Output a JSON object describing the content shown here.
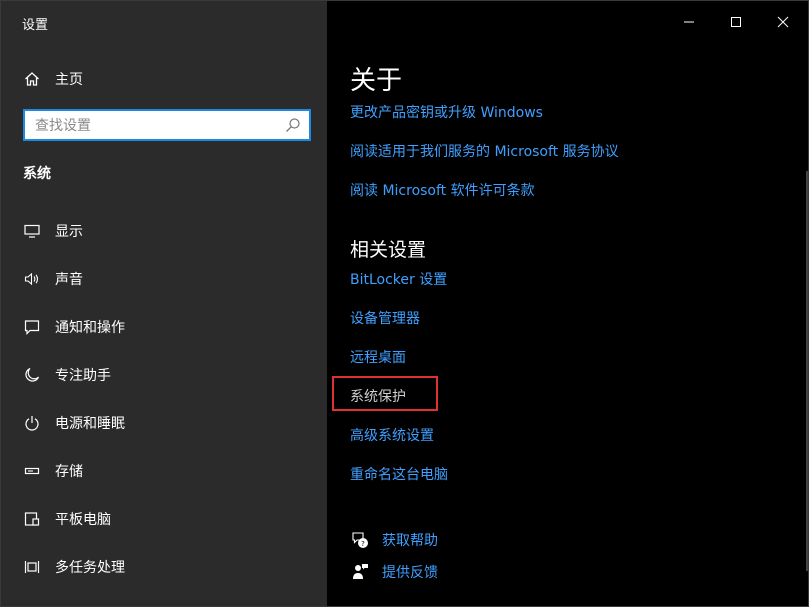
{
  "app": {
    "title": "设置"
  },
  "colors": {
    "link": "#3fa0ff",
    "sidebar_bg": "#2b2b2b",
    "main_bg": "#000000",
    "search_border": "#1e88e5",
    "highlight": "#e03131"
  },
  "sidebar": {
    "home": {
      "label": "主页",
      "icon": "home-icon"
    },
    "search": {
      "placeholder": "查找设置",
      "icon": "search-icon"
    },
    "section_title": "系统",
    "items": [
      {
        "label": "显示",
        "icon": "monitor-icon"
      },
      {
        "label": "声音",
        "icon": "speaker-icon"
      },
      {
        "label": "通知和操作",
        "icon": "notification-icon"
      },
      {
        "label": "专注助手",
        "icon": "moon-icon"
      },
      {
        "label": "电源和睡眠",
        "icon": "power-icon"
      },
      {
        "label": "存储",
        "icon": "storage-icon"
      },
      {
        "label": "平板电脑",
        "icon": "tablet-icon"
      },
      {
        "label": "多任务处理",
        "icon": "multitasking-icon"
      }
    ]
  },
  "titlebar": {
    "minimize": "minimize-icon",
    "maximize": "maximize-icon",
    "close": "close-icon"
  },
  "main": {
    "heading": "关于",
    "about_links": [
      "更改产品密钥或升级 Windows",
      "阅读适用于我们服务的 Microsoft 服务协议",
      "阅读 Microsoft 软件许可条款"
    ],
    "related_heading": "相关设置",
    "related_links": [
      "BitLocker 设置",
      "设备管理器",
      "远程桌面",
      "系统保护",
      "高级系统设置",
      "重命名这台电脑"
    ],
    "help": [
      {
        "label": "获取帮助",
        "icon": "help-chat-icon"
      },
      {
        "label": "提供反馈",
        "icon": "feedback-icon"
      }
    ]
  }
}
